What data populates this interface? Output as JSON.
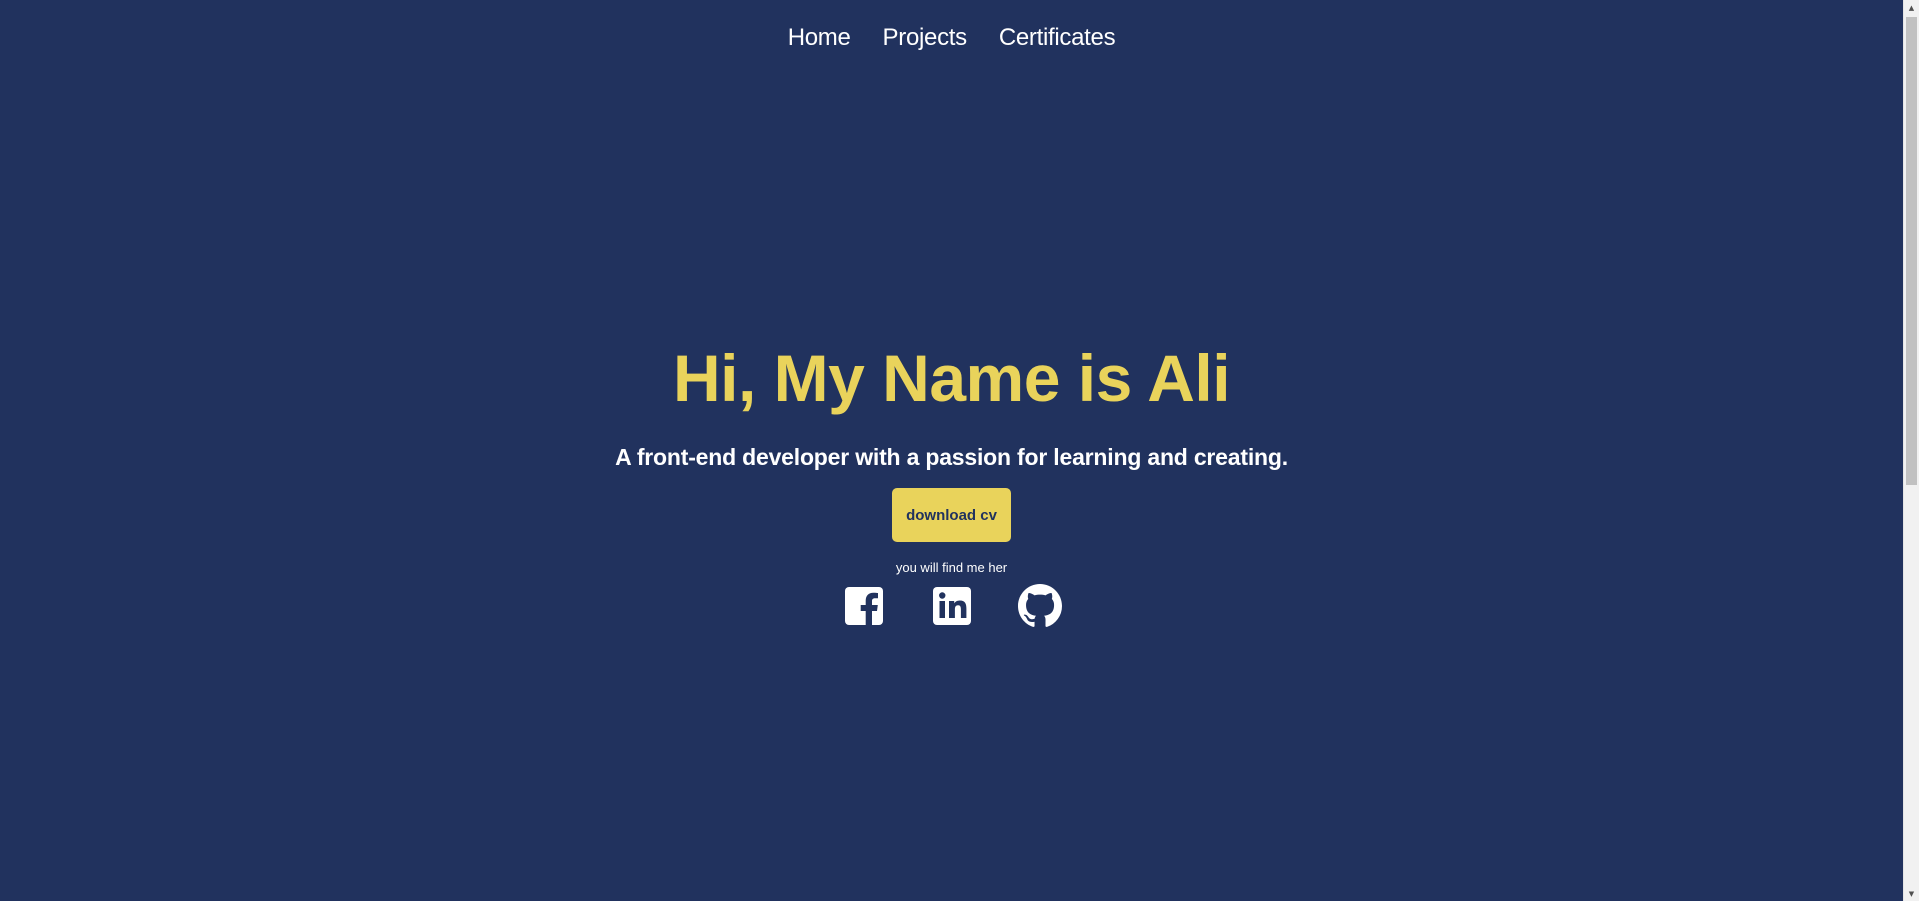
{
  "nav": {
    "items": [
      {
        "label": "Home"
      },
      {
        "label": "Projects"
      },
      {
        "label": "Certificates"
      }
    ]
  },
  "hero": {
    "title": "Hi, My Name is Ali",
    "tagline": "A front-end developer with a passion for learning and creating.",
    "cv_button_label": "download cv",
    "find_text": "you will find me her"
  },
  "socials": [
    {
      "icon": "facebook-icon"
    },
    {
      "icon": "linkedin-icon"
    },
    {
      "icon": "github-icon"
    }
  ],
  "colors": {
    "background": "#21325e",
    "accent": "#e9d35b",
    "text": "#ffffff"
  }
}
